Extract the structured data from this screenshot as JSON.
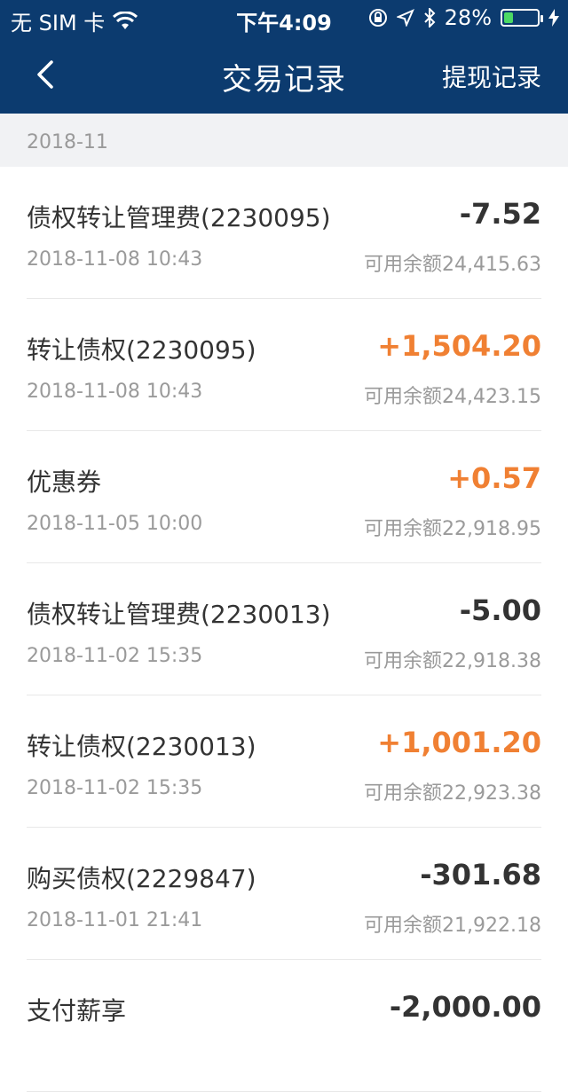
{
  "status_bar": {
    "carrier": "无 SIM 卡",
    "time": "下午4:09",
    "battery": "28%",
    "battery_fraction": 0.28
  },
  "nav": {
    "title": "交易记录",
    "right_link": "提现记录"
  },
  "section": {
    "month": "2018-11"
  },
  "transactions": [
    {
      "name": "债权转让管理费(2230095)",
      "amount": "-7.52",
      "time": "2018-11-08 10:43",
      "balance": "可用余额24,415.63",
      "positive": false
    },
    {
      "name": "转让债权(2230095)",
      "amount": "+1,504.20",
      "time": "2018-11-08 10:43",
      "balance": "可用余额24,423.15",
      "positive": true
    },
    {
      "name": "优惠券",
      "amount": "+0.57",
      "time": "2018-11-05 10:00",
      "balance": "可用余额22,918.95",
      "positive": true
    },
    {
      "name": "债权转让管理费(2230013)",
      "amount": "-5.00",
      "time": "2018-11-02 15:35",
      "balance": "可用余额22,918.38",
      "positive": false
    },
    {
      "name": "转让债权(2230013)",
      "amount": "+1,001.20",
      "time": "2018-11-02 15:35",
      "balance": "可用余额22,923.38",
      "positive": true
    },
    {
      "name": "购买债权(2229847)",
      "amount": "-301.68",
      "time": "2018-11-01 21:41",
      "balance": "可用余额21,922.18",
      "positive": false
    },
    {
      "name": "支付薪享",
      "amount": "-2,000.00",
      "time": "",
      "balance": "",
      "positive": false
    }
  ],
  "colors": {
    "nav_bg": "#0c3b6f",
    "positive": "#f08033",
    "negative": "#333333"
  }
}
